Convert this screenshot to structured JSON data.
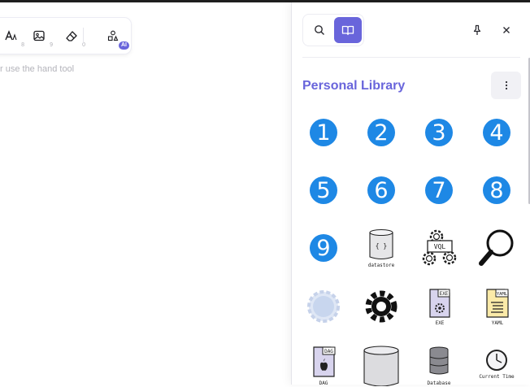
{
  "toolbar": {
    "text_key": "8",
    "image_key": "9",
    "eraser_key": "0",
    "ai_badge": "AI"
  },
  "canvas": {
    "hint": "r use the hand tool"
  },
  "sidebar": {
    "title": "Personal Library",
    "accent": "#6965db",
    "number_items": [
      "1",
      "2",
      "3",
      "4",
      "5",
      "6",
      "7",
      "8",
      "9"
    ],
    "captions": {
      "datastore": "datastore",
      "vql_box": "VQL",
      "exe_box": "EXE",
      "exe_label": "EXE",
      "yaml_box": "YAML",
      "yaml_label": "YAML",
      "dag_box": "DAG",
      "dag_label": "DAG",
      "database_label": "Database",
      "time_label": "Current Time",
      "json_braces": "{ }"
    },
    "icons": [
      "search-icon",
      "library-icon",
      "pin-icon",
      "close-icon",
      "more-vertical-icon"
    ],
    "number_color": "#1e88e5"
  }
}
